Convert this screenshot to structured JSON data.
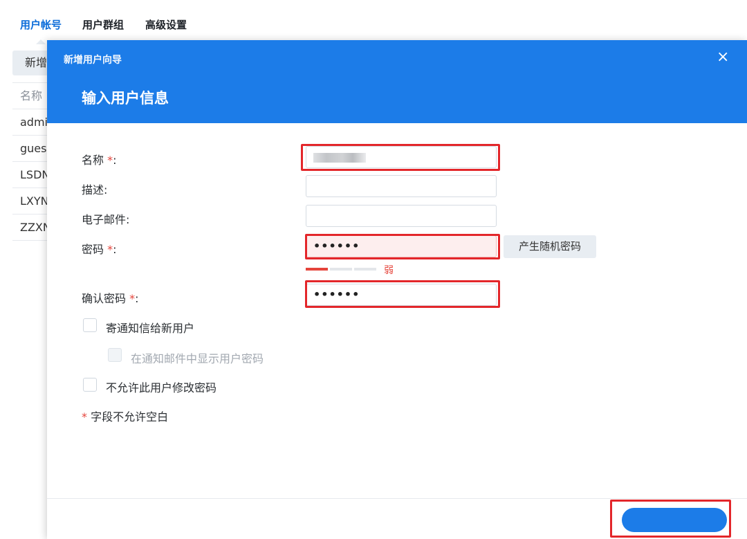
{
  "tabs": [
    "用户帐号",
    "用户群组",
    "高级设置"
  ],
  "toolbar": {
    "new_label": "新增"
  },
  "list": {
    "header": "名称",
    "rows": [
      "admi",
      "gues",
      "LSDN",
      "LXYN",
      "ZZXN"
    ]
  },
  "dialog": {
    "wizard_title": "新增用户向导",
    "step_title": "输入用户信息",
    "close_icon": "×",
    "fields": {
      "name_label": "名称",
      "desc_label": "描述:",
      "email_label": "电子邮件:",
      "password_label": "密码",
      "confirm_label": "确认密码",
      "required_mark": "*",
      "colon": ":",
      "password_value": "••••••",
      "confirm_value": "••••••"
    },
    "generate_button": "产生随机密码",
    "strength": {
      "label": "弱",
      "level": "weak",
      "color": "#e5443b"
    },
    "checkboxes": {
      "send_notice": "寄通知信给新用户",
      "show_password": "在通知邮件中显示用户密码",
      "disallow_change": "不允许此用户修改密码"
    },
    "required_note": "字段不允许空白"
  },
  "colors": {
    "accent": "#1c7ce8",
    "highlight": "#e3262a",
    "error": "#e5443b"
  }
}
